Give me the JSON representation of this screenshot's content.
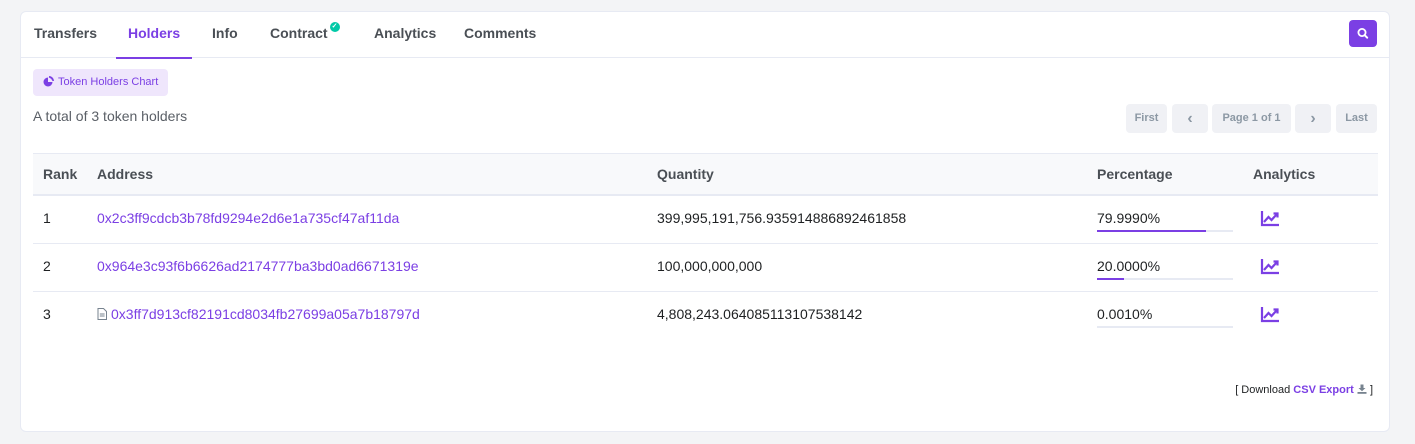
{
  "tabs": [
    {
      "label": "Transfers"
    },
    {
      "label": "Holders",
      "active": true
    },
    {
      "label": "Info"
    },
    {
      "label": "Contract",
      "verified": true
    },
    {
      "label": "Analytics"
    },
    {
      "label": "Comments"
    }
  ],
  "chart_button": {
    "label": "Token Holders Chart"
  },
  "summary": {
    "total_text": "A total of 3 token holders"
  },
  "pagination": {
    "first": "First",
    "prev": "‹",
    "page": "Page 1 of 1",
    "next": "›",
    "last": "Last"
  },
  "table": {
    "headers": {
      "rank": "Rank",
      "address": "Address",
      "quantity": "Quantity",
      "percentage": "Percentage",
      "analytics": "Analytics"
    },
    "rows": [
      {
        "rank": "1",
        "address": "0x2c3ff9cdcb3b78fd9294e2d6e1a735cf47af11da",
        "is_contract": false,
        "quantity": "399,995,191,756.935914886892461858",
        "percentage": "79.9990%",
        "pct_fraction": 0.79999
      },
      {
        "rank": "2",
        "address": "0x964e3c93f6b6626ad2174777ba3bd0ad6671319e",
        "is_contract": false,
        "quantity": "100,000,000,000",
        "percentage": "20.0000%",
        "pct_fraction": 0.2
      },
      {
        "rank": "3",
        "address": "0x3ff7d913cf82191cd8034fb27699a05a7b18797d",
        "is_contract": true,
        "quantity": "4,808,243.064085113107538142",
        "percentage": "0.0010%",
        "pct_fraction": 1e-05
      }
    ]
  },
  "footer": {
    "prefix": "[ Download",
    "csv_label": "CSV Export",
    "suffix": "]"
  },
  "colors": {
    "accent": "#7b3fe4",
    "verified": "#00c9a7"
  }
}
